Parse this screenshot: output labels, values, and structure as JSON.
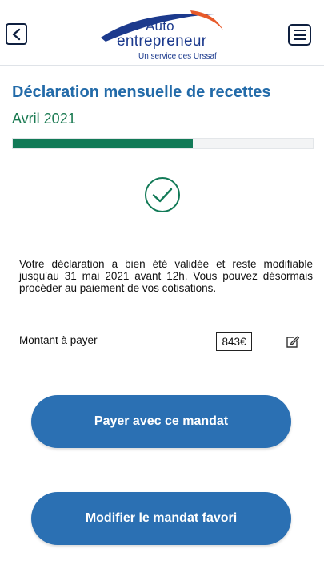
{
  "header": {
    "logo_line1": "Auto",
    "logo_line2": "entrepreneur",
    "logo_subline": "Un service des Urssaf",
    "back_icon": "chevron-left-icon",
    "menu_icon": "hamburger-menu-icon"
  },
  "main": {
    "title": "Déclaration mensuelle de recettes",
    "period": "Avril 2021",
    "progress_fraction": 0.6,
    "status_icon": "check-circle-icon",
    "confirmation_message": "Votre déclaration a bien été validée et reste modifiable jusqu'au 31 mai 2021 avant 12h. Vous pouvez désormais procéder au paiement de vos cotisations.",
    "amount_label": "Montant à payer",
    "amount_value": "843€",
    "edit_icon": "edit-icon"
  },
  "actions": {
    "pay_label": "Payer avec ce mandat",
    "modify_label": "Modifier le mandat favori"
  },
  "colors": {
    "primary_blue": "#2b70b3",
    "title_blue": "#236ba9",
    "green": "#127a57",
    "logo_blue": "#1c3a8d",
    "logo_orange": "#e75a2a"
  }
}
